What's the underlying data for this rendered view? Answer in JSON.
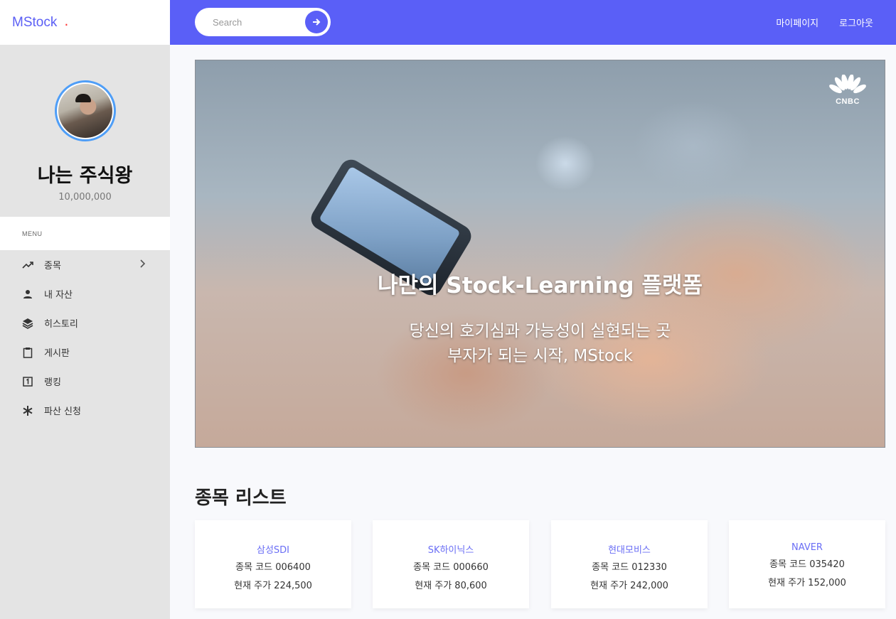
{
  "brand": {
    "name": "MStock",
    "dot": "."
  },
  "profile": {
    "name": "나는 주식왕",
    "balance": "10,000,000"
  },
  "menu": {
    "header": "MENU",
    "items": [
      {
        "label": "종목",
        "icon": "trending-up-icon",
        "has_submenu": true
      },
      {
        "label": "내 자산",
        "icon": "person-icon"
      },
      {
        "label": "히스토리",
        "icon": "layers-icon"
      },
      {
        "label": "게시판",
        "icon": "clipboard-icon"
      },
      {
        "label": "랭킹",
        "icon": "number-one-icon"
      },
      {
        "label": "파산 신청",
        "icon": "asterisk-icon"
      }
    ]
  },
  "topbar": {
    "search_placeholder": "Search",
    "links": [
      "마이페이지",
      "로그아웃"
    ]
  },
  "hero": {
    "logo_text": "CNBC",
    "title": "나만의 Stock-Learning 플랫폼",
    "subtitle_line1": "당신의 호기심과 가능성이 실현되는 곳",
    "subtitle_line2": "부자가 되는 시작, MStock"
  },
  "stock_list": {
    "title": "종목 리스트",
    "cards": [
      {
        "name": "삼성SDI",
        "code": "종목 코드 006400",
        "price": "현재 주가 224,500"
      },
      {
        "name": "SK하이닉스",
        "code": "종목 코드 000660",
        "price": "현재 주가 80,600"
      },
      {
        "name": "현대모비스",
        "code": "종목 코드 012330",
        "price": "현재 주가 242,000"
      },
      {
        "name": "NAVER",
        "code": "종목 코드 035420",
        "price": "현재 주가 152,000"
      }
    ]
  },
  "colors": {
    "accent": "#5a5ff7",
    "sidebar_bg": "#e4e4e4",
    "brand_dot": "#ff3333"
  }
}
